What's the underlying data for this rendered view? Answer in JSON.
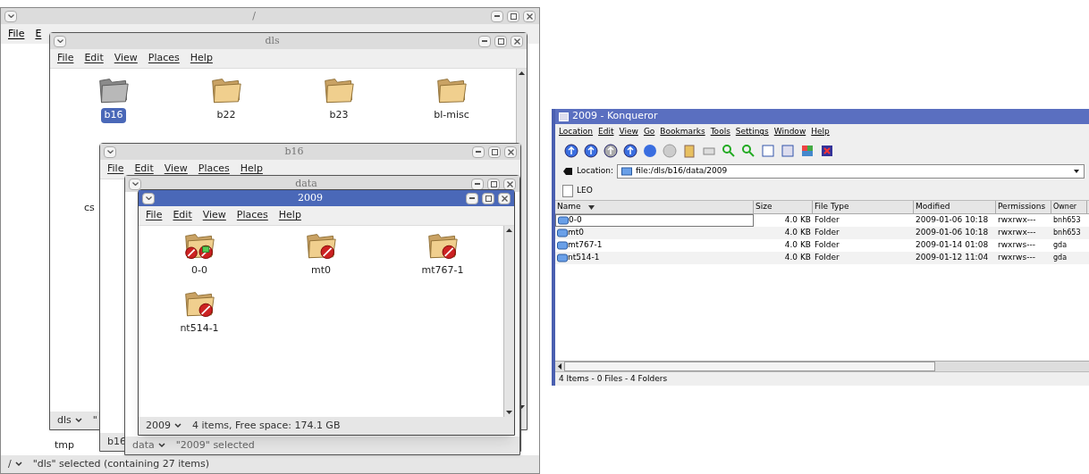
{
  "root_window": {
    "title": "/",
    "menu": [
      "File",
      "E"
    ],
    "items": [
      "tmp"
    ],
    "status_location": "/",
    "status_text": "\"dls\" selected (containing 27 items)"
  },
  "dls_window": {
    "title": "dls",
    "active": false,
    "menu": [
      "File",
      "Edit",
      "View",
      "Places",
      "Help"
    ],
    "items": [
      {
        "label": "b16",
        "kind": "open",
        "selected": true
      },
      {
        "label": "b22",
        "kind": "plain",
        "selected": false
      },
      {
        "label": "b23",
        "kind": "plain",
        "selected": false
      },
      {
        "label": "bl-misc",
        "kind": "plain",
        "selected": false
      }
    ],
    "side_label": "cs",
    "status_location": "dls",
    "status_text": "\""
  },
  "b16_window": {
    "title": "b16",
    "active": false,
    "menu": [
      "File",
      "Edit",
      "View",
      "Places",
      "Help"
    ],
    "status_location": "b16"
  },
  "data_window": {
    "title": "data",
    "active": false,
    "status_location": "data",
    "status_text": "\"2009\" selected"
  },
  "folder_window": {
    "title": "2009",
    "active": true,
    "menu": [
      "File",
      "Edit",
      "View",
      "Places",
      "Help"
    ],
    "items": [
      {
        "label": "0-0",
        "kind": "locked_shared",
        "selected": false
      },
      {
        "label": "mt0",
        "kind": "locked",
        "selected": false
      },
      {
        "label": "mt767-1",
        "kind": "locked",
        "selected": false
      },
      {
        "label": "nt514-1",
        "kind": "locked",
        "selected": false
      }
    ],
    "status_location": "2009",
    "status_text": "4 items, Free space: 174.1 GB"
  },
  "konqueror": {
    "title": "2009 - Konqueror",
    "active": true,
    "menu": [
      "Location",
      "Edit",
      "View",
      "Go",
      "Bookmarks",
      "Tools",
      "Settings",
      "Window",
      "Help"
    ],
    "location_label": "Location:",
    "location": "file:/dls/b16/data/2009",
    "bookmarks": [
      "LEO"
    ],
    "columns": [
      "Name",
      "Size",
      "File Type",
      "Modified",
      "Permissions",
      "Owner"
    ],
    "rows": [
      {
        "cells": [
          "0-0",
          "4.0 KB",
          "Folder",
          "2009-01-06 10:18",
          "rwxrwx---",
          "bnh653"
        ],
        "focused": true
      },
      {
        "cells": [
          "mt0",
          "4.0 KB",
          "Folder",
          "2009-01-06 10:18",
          "rwxrwx---",
          "bnh653"
        ],
        "focused": false
      },
      {
        "cells": [
          "mt767-1",
          "4.0 KB",
          "Folder",
          "2009-01-14 01:08",
          "rwxrws---",
          "gda"
        ],
        "focused": false
      },
      {
        "cells": [
          "nt514-1",
          "4.0 KB",
          "Folder",
          "2009-01-12 11:04",
          "rwxrws---",
          "gda"
        ],
        "focused": false
      }
    ],
    "status": "4 Items - 0 Files - 4 Folders"
  }
}
